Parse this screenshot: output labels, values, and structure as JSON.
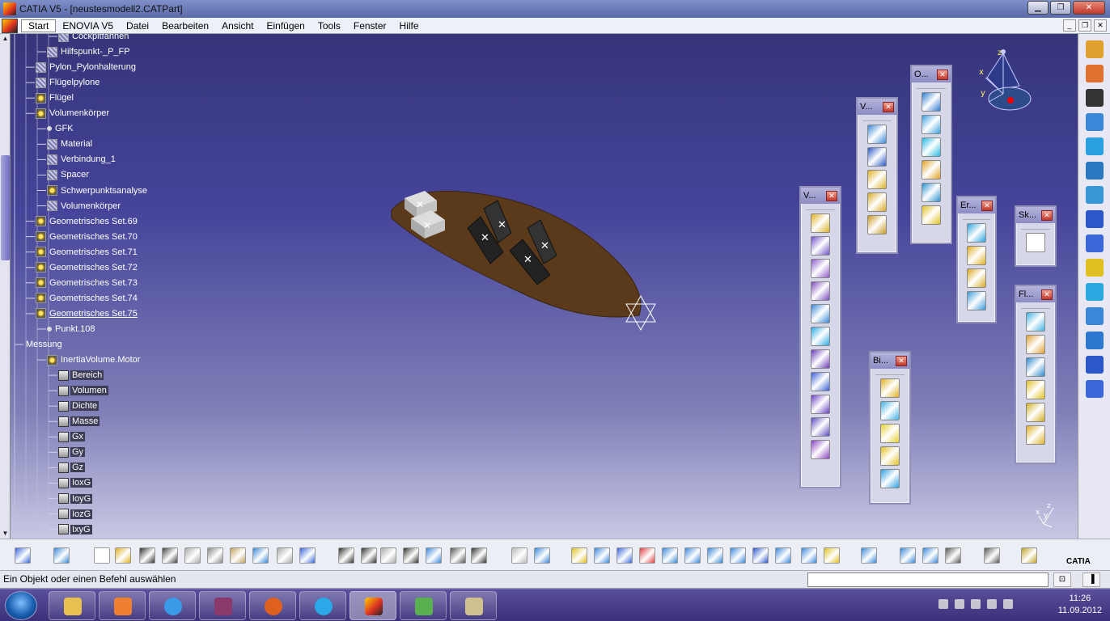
{
  "window": {
    "title": "CATIA V5 - [neustesmodell2.CATPart]",
    "min": "▁",
    "max": "❐",
    "close": "✕"
  },
  "menu": {
    "items": [
      "Start",
      "ENOVIA V5",
      "Datei",
      "Bearbeiten",
      "Ansicht",
      "Einfügen",
      "Tools",
      "Fenster",
      "Hilfe"
    ]
  },
  "tree": {
    "nodes": [
      {
        "label": "Cockpitfahnen",
        "level": 3,
        "icon": "surface"
      },
      {
        "label": "Hilfspunkt-_P_FP",
        "level": 2,
        "icon": "surface"
      },
      {
        "label": "Pylon_Pylonhalterung",
        "level": 1,
        "icon": "surface"
      },
      {
        "label": "Flügelpylone",
        "level": 1,
        "icon": "surface"
      },
      {
        "label": "Flügel",
        "level": 1,
        "icon": "gear"
      },
      {
        "label": "Volumenkörper",
        "level": 1,
        "icon": "gear"
      },
      {
        "label": "GFK",
        "level": 2,
        "icon": "dot"
      },
      {
        "label": "Material",
        "level": 2,
        "icon": "surface"
      },
      {
        "label": "Verbindung_1",
        "level": 2,
        "icon": "surface"
      },
      {
        "label": "Spacer",
        "level": 2,
        "icon": "surface"
      },
      {
        "label": "Schwerpunktsanalyse",
        "level": 2,
        "icon": "gear"
      },
      {
        "label": "Volumenkörper",
        "level": 2,
        "icon": "surface"
      },
      {
        "label": "Geometrisches Set.69",
        "level": 1,
        "icon": "gear"
      },
      {
        "label": "Geometrisches Set.70",
        "level": 1,
        "icon": "gear"
      },
      {
        "label": "Geometrisches Set.71",
        "level": 1,
        "icon": "gear"
      },
      {
        "label": "Geometrisches Set.72",
        "level": 1,
        "icon": "gear"
      },
      {
        "label": "Geometrisches Set.73",
        "level": 1,
        "icon": "gear"
      },
      {
        "label": "Geometrisches Set.74",
        "level": 1,
        "icon": "gear"
      },
      {
        "label": "Geometrisches Set.75",
        "level": 1,
        "icon": "gear"
      },
      {
        "label": "Punkt.108",
        "level": 2,
        "icon": "dot"
      },
      {
        "label": "Messung",
        "level": 0,
        "icon": "none"
      },
      {
        "label": "InertiaVolume.Motor",
        "level": 2,
        "icon": "gear"
      },
      {
        "label": "Bereich",
        "level": 3,
        "icon": "param"
      },
      {
        "label": "Volumen",
        "level": 3,
        "icon": "param"
      },
      {
        "label": "Dichte",
        "level": 3,
        "icon": "param"
      },
      {
        "label": "Masse",
        "level": 3,
        "icon": "param"
      },
      {
        "label": "Gx",
        "level": 3,
        "icon": "param"
      },
      {
        "label": "Gy",
        "level": 3,
        "icon": "param"
      },
      {
        "label": "Gz",
        "level": 3,
        "icon": "param"
      },
      {
        "label": "IoxG",
        "level": 3,
        "icon": "param"
      },
      {
        "label": "IoyG",
        "level": 3,
        "icon": "param"
      },
      {
        "label": "IozG",
        "level": 3,
        "icon": "param"
      },
      {
        "label": "IxyG",
        "level": 3,
        "icon": "param"
      }
    ]
  },
  "compass": {
    "x": "x",
    "y": "y",
    "z": "z"
  },
  "mini_axis": {
    "x": "x",
    "y": "y",
    "z": "z"
  },
  "toolbars": [
    {
      "title": "V...",
      "colors": [
        "#e0b020",
        "#7050c8",
        "#8a5ac8",
        "#7a4ab8",
        "#3a88d8",
        "#2aa8e0",
        "#6a3ab8",
        "#3a60d8",
        "#6a40c0",
        "#5a4ac0",
        "#8a40c0"
      ]
    },
    {
      "title": "V...",
      "colors": [
        "#3a88d8",
        "#2a58c8",
        "#e0b020",
        "#d8a820",
        "#c89820"
      ]
    },
    {
      "title": "O...",
      "colors": [
        "#2a78d0",
        "#3aa0e0",
        "#20b8e0",
        "#e0a020",
        "#2a90d0",
        "#e0c020"
      ]
    },
    {
      "title": "Er...",
      "colors": [
        "#2aa0e0",
        "#e0b020",
        "#d8a820",
        "#3a98d8"
      ]
    },
    {
      "title": "Sk...",
      "colors": [
        "#ffffff"
      ]
    },
    {
      "title": "Fl...",
      "colors": [
        "#40b0e0",
        "#e0a030",
        "#2a88d0",
        "#e0c020",
        "#d0b020",
        "#e0b020"
      ]
    },
    {
      "title": "Bi...",
      "colors": [
        "#e0b020",
        "#40b0e0",
        "#e8d030",
        "#e0c020",
        "#2aa0e0"
      ]
    }
  ],
  "status": {
    "message": "Ein Objekt oder einen Befehl auswählen"
  },
  "taskbar": {
    "time": "11:26",
    "date": "11.09.2012"
  },
  "logo": {
    "text": "CATIA"
  }
}
